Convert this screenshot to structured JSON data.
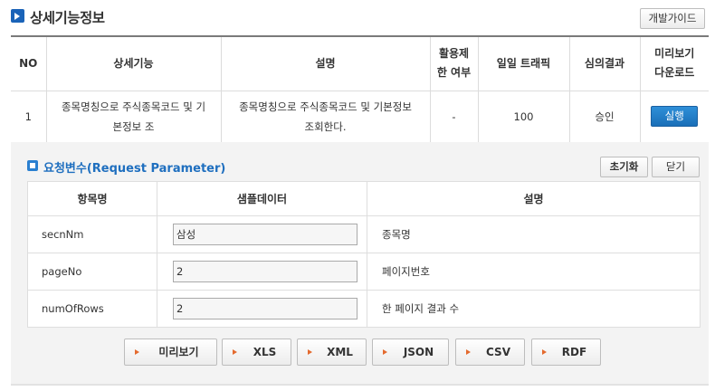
{
  "header": {
    "title": "상세기능정보",
    "dev_guide_label": "개발가이드"
  },
  "main_table": {
    "columns": [
      "NO",
      "상세기능",
      "설명",
      "활용제\n한 여부",
      "일일 트래픽",
      "심의결과",
      "미리보기\n다운로드"
    ],
    "rows": [
      {
        "no": "1",
        "function": "종목명칭으로 주식종목코드 및 기\n본정보 조",
        "description": "종목명칭으로 주식종목코드 및 기본정보\n조회한다.",
        "usage_limit": "-",
        "daily_traffic": "100",
        "review_result": "승인",
        "action_label": "실행"
      }
    ]
  },
  "request": {
    "title": "요청변수(Request Parameter)",
    "reset_label": "초기화",
    "close_label": "닫기",
    "columns": [
      "항목명",
      "샘플데이터",
      "설명"
    ],
    "params": [
      {
        "name": "secnNm",
        "value": "삼성",
        "description": "종목명"
      },
      {
        "name": "pageNo",
        "value": "2",
        "description": "페이지번호"
      },
      {
        "name": "numOfRows",
        "value": "2",
        "description": "한 페이지 결과 수"
      }
    ],
    "formats": [
      "미리보기",
      "XLS",
      "XML",
      "JSON",
      "CSV",
      "RDF"
    ]
  },
  "colors": {
    "accent_blue": "#1a63b8",
    "title_blue": "#1f6fbf",
    "arrow_orange": "#e46a2e",
    "panel_bg": "#f3f3f3"
  }
}
